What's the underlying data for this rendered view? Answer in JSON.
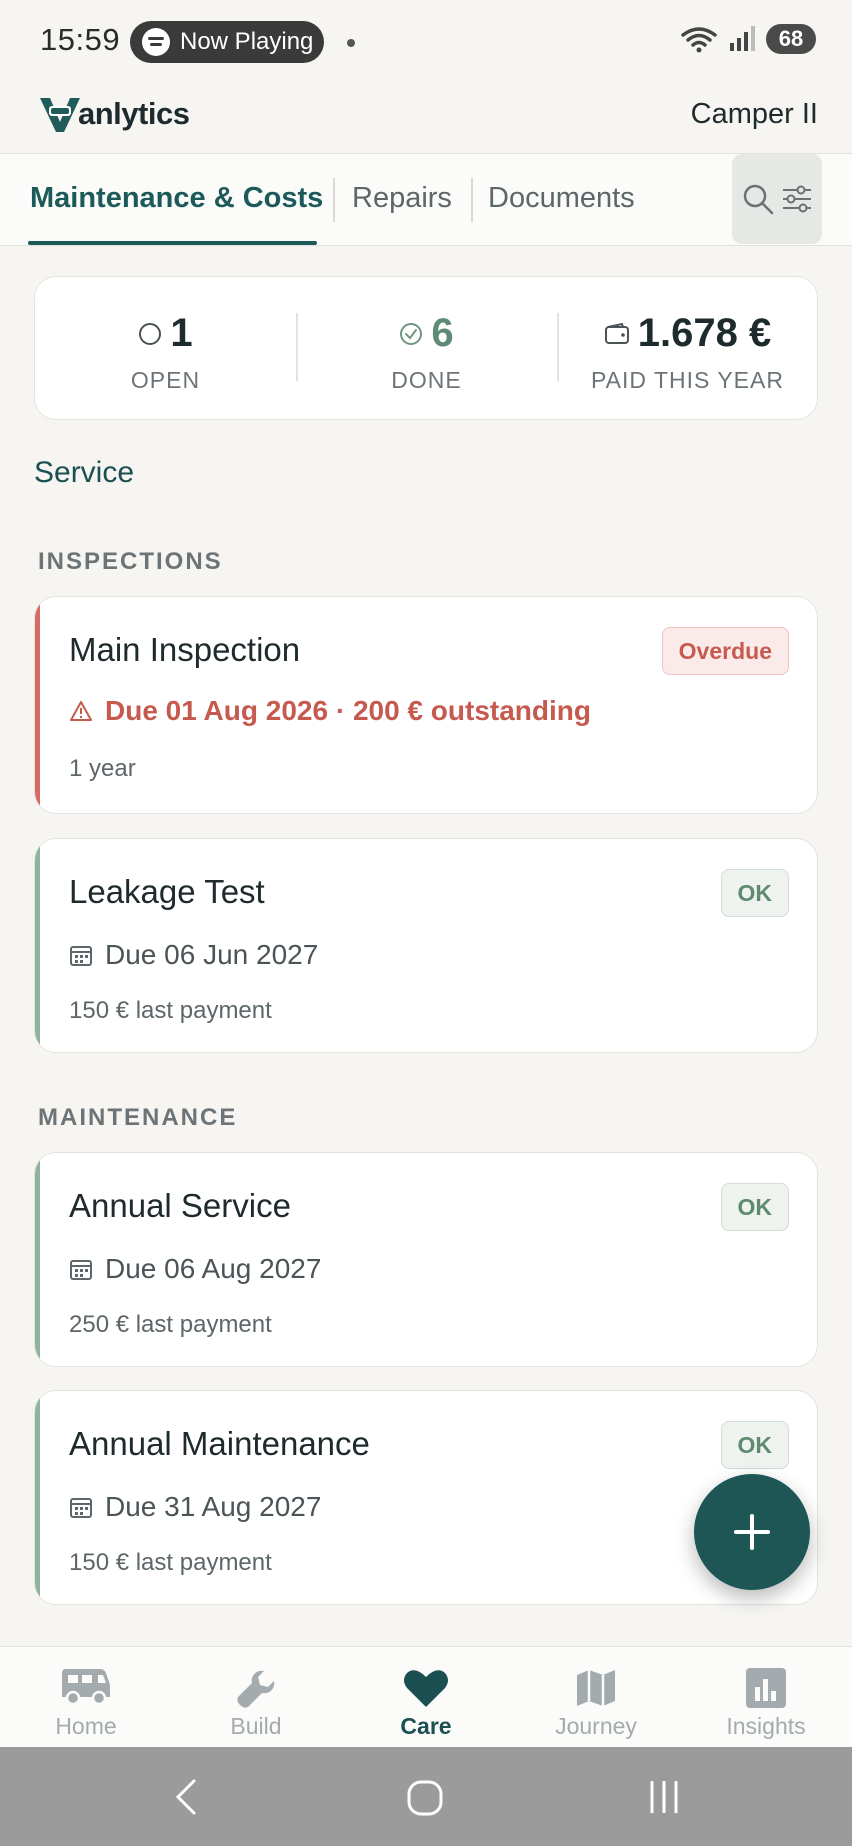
{
  "status_bar": {
    "time": "15:59",
    "now_playing": "Now Playing",
    "battery": "68"
  },
  "header": {
    "logo_text": "anlytics",
    "vehicle_name": "Camper II"
  },
  "tabs": [
    {
      "label": "Maintenance & Costs",
      "active": true
    },
    {
      "label": "Repairs",
      "active": false
    },
    {
      "label": "Documents",
      "active": false
    }
  ],
  "summary": {
    "open_value": "1",
    "open_label": "OPEN",
    "done_value": "6",
    "done_label": "DONE",
    "paid_value": "1.678 €",
    "paid_label": "PAID THIS YEAR"
  },
  "section_title": "Service",
  "groups": {
    "inspections": "INSPECTIONS",
    "maintenance": "MAINTENANCE"
  },
  "tasks": [
    {
      "title": "Main Inspection",
      "due": "Due 01 Aug 2026 · 200 € outstanding",
      "sub": "1 year",
      "status": "Overdue"
    },
    {
      "title": "Leakage Test",
      "due": "Due 06 Jun 2027",
      "sub": "150 € last payment",
      "status": "OK"
    },
    {
      "title": "Annual Service",
      "due": "Due 06 Aug 2027",
      "sub": "250 € last payment",
      "status": "OK"
    },
    {
      "title": "Annual Maintenance",
      "due": "Due 31 Aug 2027",
      "sub": "150 € last payment",
      "status": "OK"
    }
  ],
  "bottom_nav": [
    {
      "label": "Home",
      "icon": "camper-van-icon"
    },
    {
      "label": "Build",
      "icon": "wrench-icon"
    },
    {
      "label": "Care",
      "icon": "heart-icon",
      "active": true
    },
    {
      "label": "Journey",
      "icon": "map-icon"
    },
    {
      "label": "Insights",
      "icon": "bar-chart-icon"
    }
  ],
  "colors": {
    "brand": "#1c5a5a",
    "ok_accent": "#8fb39c",
    "overdue_accent": "#d96a63",
    "background": "#f6f5f2"
  }
}
